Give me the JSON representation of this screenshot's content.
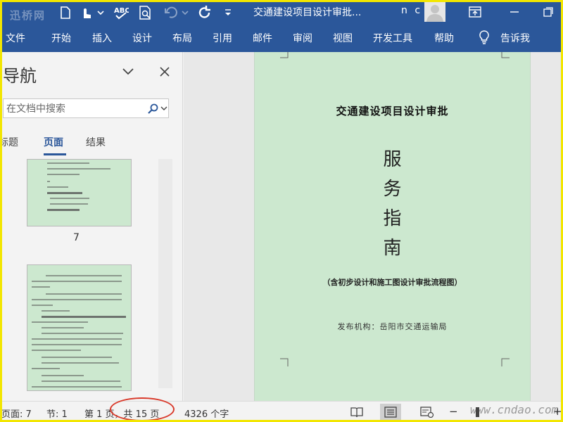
{
  "titlebar": {
    "watermark": "迅桥网",
    "doc_title": "交通建设项目设计审批...",
    "user": "n c"
  },
  "ribbon": {
    "tabs": [
      "文件",
      "开始",
      "插入",
      "设计",
      "布局",
      "引用",
      "邮件",
      "审阅",
      "视图",
      "开发工具",
      "帮助",
      "告诉我"
    ]
  },
  "nav": {
    "title": "导航",
    "search_placeholder": "在文档中搜索",
    "tabs": [
      "标题",
      "页面",
      "结果"
    ],
    "active_tab": "页面",
    "thumb_page_label": "7"
  },
  "document": {
    "title": "交通建设项目设计审批",
    "big_chars": [
      "服",
      "务",
      "指",
      "南"
    ],
    "subtitle": "（含初步设计和施工图设计审批流程图）",
    "publisher": "发布机构：岳阳市交通运输局"
  },
  "status": {
    "page": "页面: 7",
    "section": "节: 1",
    "page_of": "第 1 页，共 15 页",
    "words": "4326 个字",
    "zoom_minus": "−",
    "zoom_plus": "+",
    "watermark": "www.cndao.com"
  },
  "colors": {
    "ribbon": "#2b579a",
    "page_bg": "#cce8cf",
    "highlight_circle": "#d93a2b",
    "frame": "#f2e600"
  },
  "icons": {
    "quick_access": [
      "file-icon",
      "touch-mode-icon",
      "spelling-icon",
      "print-preview-icon",
      "undo-icon",
      "redo-icon",
      "customize-icon"
    ],
    "nav": [
      "chevron-down-icon",
      "close-icon",
      "search-icon"
    ],
    "status": [
      "read-mode-icon",
      "print-layout-icon",
      "web-layout-icon"
    ]
  }
}
